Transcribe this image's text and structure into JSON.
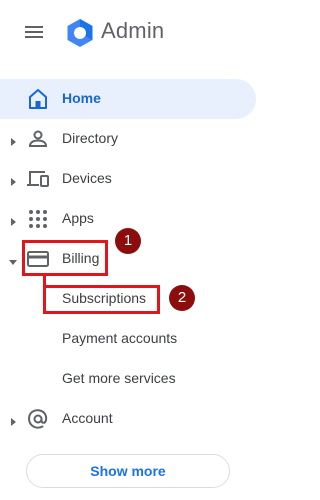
{
  "header": {
    "app_title": "Admin",
    "menu_icon": "hamburger-menu-icon",
    "logo_icon": "google-admin-hexagon-logo"
  },
  "colors": {
    "accent": "#1a73e8",
    "active_bg": "#e8f0fe",
    "highlight": "#e4141b",
    "badge": "#8b0d0d"
  },
  "nav": {
    "home": {
      "label": "Home",
      "icon": "home-icon",
      "active": true
    },
    "directory": {
      "label": "Directory",
      "icon": "person-icon"
    },
    "devices": {
      "label": "Devices",
      "icon": "devices-icon"
    },
    "apps": {
      "label": "Apps",
      "icon": "apps-grid-icon"
    },
    "billing": {
      "label": "Billing",
      "icon": "credit-card-icon",
      "expanded": true
    },
    "billing_children": [
      "Subscriptions",
      "Payment accounts",
      "Get more services"
    ],
    "account": {
      "label": "Account",
      "icon": "at-sign-icon"
    }
  },
  "annotations": {
    "step1": "1",
    "step2": "2"
  },
  "show_more_label": "Show more"
}
